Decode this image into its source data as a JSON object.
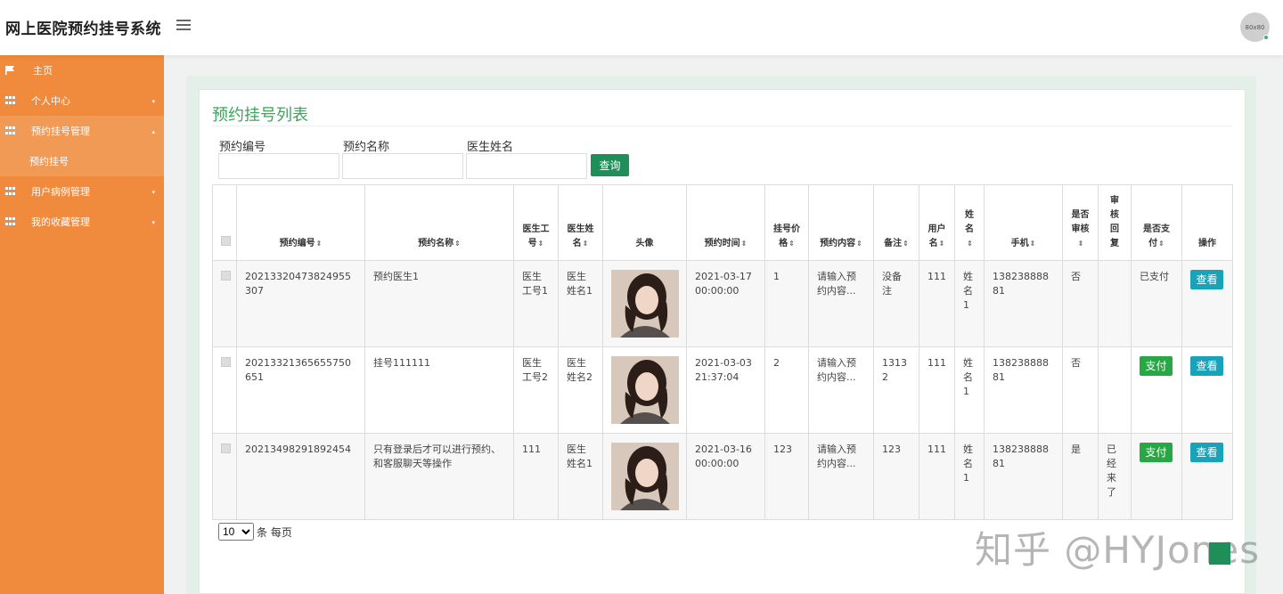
{
  "header": {
    "title": "网上医院预约挂号系统",
    "avatar_text": "80x80"
  },
  "sidebar": {
    "items": [
      {
        "label": "主页"
      },
      {
        "label": "个人中心"
      },
      {
        "label": "预约挂号管理"
      },
      {
        "label": "用户病例管理"
      },
      {
        "label": "我的收藏管理"
      }
    ],
    "sub_label": "预约挂号"
  },
  "main": {
    "title": "预约挂号列表",
    "filters": {
      "f1": "预约编号",
      "f2": "预约名称",
      "f3": "医生姓名"
    },
    "query_label": "查询",
    "columns": {
      "c1": "预约编号",
      "c2": "预约名称",
      "c3": "医生工号",
      "c4": "医生姓名",
      "c5": "头像",
      "c6": "预约时间",
      "c7": "挂号价格",
      "c8": "预约内容",
      "c9": "备注",
      "c10": "用户名",
      "c11": "姓名",
      "c12": "手机",
      "c13": "是否审核",
      "c14": "审核回复",
      "c15": "是否支付",
      "c16": "操作"
    },
    "rows": [
      {
        "no": "20213320473824955307",
        "name": "预约医生1",
        "doc_id": "医生工号1",
        "doc_name": "医生姓名1",
        "time": "2021-03-17 00:00:00",
        "price": "1",
        "content": "请输入预约内容...",
        "remark": "没备注",
        "user": "111",
        "real_name": "姓名1",
        "phone": "13823888881",
        "audited": "否",
        "reply": "",
        "paid": "已支付",
        "pay_btn": "",
        "view_btn": "查看"
      },
      {
        "no": "20213321365655750651",
        "name": "挂号111111",
        "doc_id": "医生工号2",
        "doc_name": "医生姓名2",
        "time": "2021-03-03 21:37:04",
        "price": "2",
        "content": "请输入预约内容...",
        "remark": "13132",
        "user": "111",
        "real_name": "姓名1",
        "phone": "13823888881",
        "audited": "否",
        "reply": "",
        "paid": "",
        "pay_btn": "支付",
        "view_btn": "查看"
      },
      {
        "no": "20213498291892454",
        "name": "只有登录后才可以进行预约、和客服聊天等操作",
        "doc_id": "111",
        "doc_name": "医生姓名1",
        "time": "2021-03-16 00:00:00",
        "price": "123",
        "content": "请输入预约内容...",
        "remark": "123",
        "user": "111",
        "real_name": "姓名1",
        "phone": "13823888881",
        "audited": "是",
        "reply": "已经来了",
        "paid": "",
        "pay_btn": "支付",
        "view_btn": "查看"
      }
    ],
    "pager": {
      "size": "10",
      "suffix": "条 每页"
    }
  },
  "watermark": "知乎 @HYJones"
}
